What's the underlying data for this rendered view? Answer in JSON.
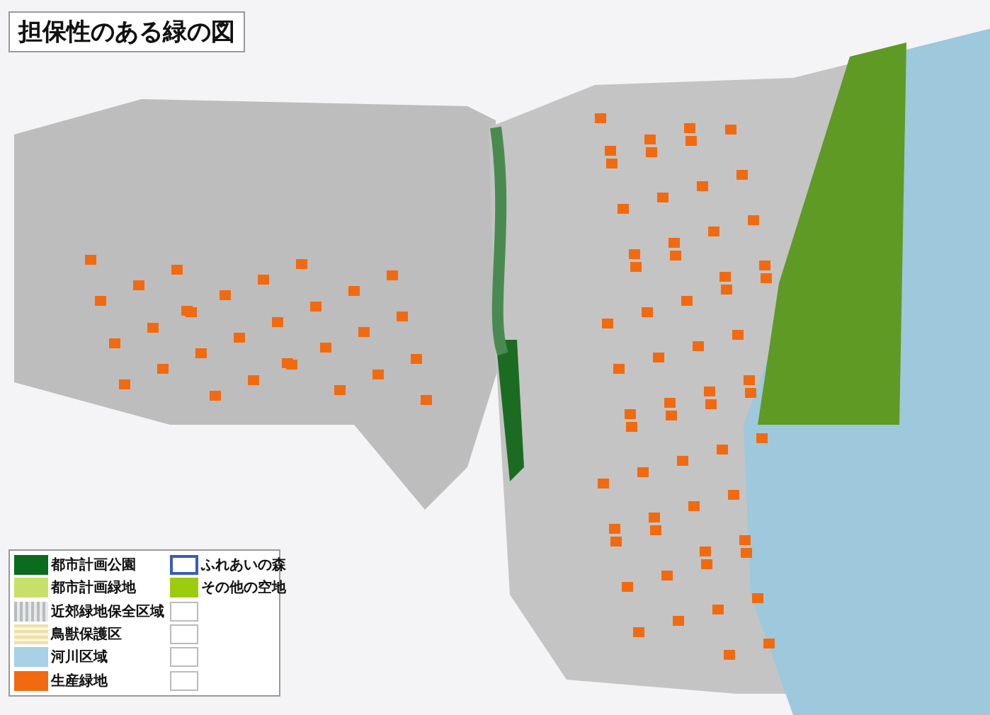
{
  "title": "担保性のある緑の図",
  "legend": {
    "left": [
      {
        "label": "都市計画公園",
        "kind": "solid",
        "color": "#0b6b1e"
      },
      {
        "label": "都市計画緑地",
        "kind": "solid",
        "color": "#c8e06a"
      },
      {
        "label": "近郊緑地保全区域",
        "kind": "vstripe",
        "color": "#b8bcc0"
      },
      {
        "label": "鳥獣保護区",
        "kind": "hstripe",
        "color": "#efe0a8"
      },
      {
        "label": "河川区域",
        "kind": "solid",
        "color": "#a8d0e6"
      },
      {
        "label": "生産緑地",
        "kind": "solid",
        "color": "#f26a10"
      }
    ],
    "right": [
      {
        "label": "ふれあいの森",
        "kind": "outline",
        "color": "#3a5bc0"
      },
      {
        "label": "その他の空地",
        "kind": "solid",
        "color": "#9ccc10"
      },
      {
        "kind": "blank"
      },
      {
        "kind": "blank"
      },
      {
        "kind": "blank"
      },
      {
        "kind": "blank"
      }
    ]
  }
}
